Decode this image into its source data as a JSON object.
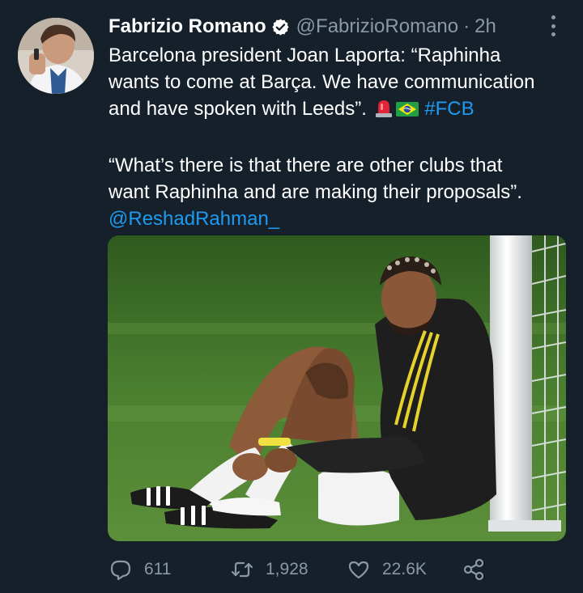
{
  "tweet": {
    "author_name": "Fabrizio Romano",
    "handle": "@FabrizioRomano",
    "separator": "·",
    "time": "2h",
    "line1": "Barcelona president Joan Laporta: “Raphinha",
    "line2": "wants to come at Barça. We have communication",
    "line3_text": "and have spoken with Leeds”.",
    "hashtag": "#FCB",
    "quote_line1": "“What’s there is that there are other clubs that",
    "quote_line2": "want Raphinha and are making their proposals”.",
    "mention": "@ReshadRahman_",
    "emojis": [
      "police-light-icon",
      "brazil-flag-icon"
    ]
  },
  "actions": {
    "replies": "611",
    "retweets": "1,928",
    "likes": "22.6K"
  },
  "colors": {
    "background": "#15202b",
    "text": "#ffffff",
    "secondary": "#8b98a5",
    "link": "#1d9bf0"
  }
}
